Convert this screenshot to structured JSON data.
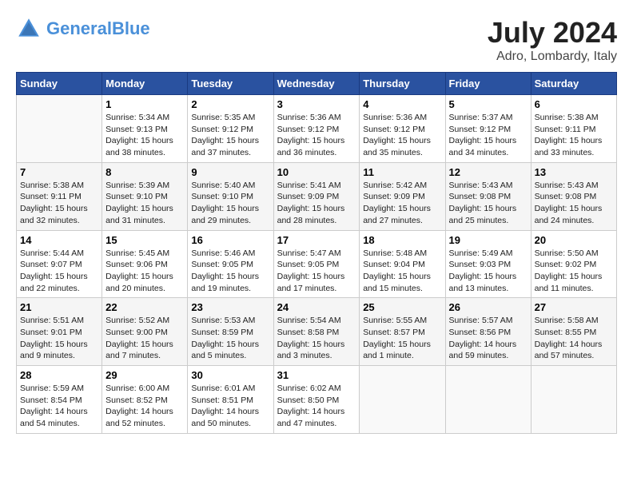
{
  "header": {
    "logo_line1": "General",
    "logo_line2": "Blue",
    "month_year": "July 2024",
    "location": "Adro, Lombardy, Italy"
  },
  "weekdays": [
    "Sunday",
    "Monday",
    "Tuesday",
    "Wednesday",
    "Thursday",
    "Friday",
    "Saturday"
  ],
  "weeks": [
    [
      {
        "day": "",
        "info": ""
      },
      {
        "day": "1",
        "info": "Sunrise: 5:34 AM\nSunset: 9:13 PM\nDaylight: 15 hours\nand 38 minutes."
      },
      {
        "day": "2",
        "info": "Sunrise: 5:35 AM\nSunset: 9:12 PM\nDaylight: 15 hours\nand 37 minutes."
      },
      {
        "day": "3",
        "info": "Sunrise: 5:36 AM\nSunset: 9:12 PM\nDaylight: 15 hours\nand 36 minutes."
      },
      {
        "day": "4",
        "info": "Sunrise: 5:36 AM\nSunset: 9:12 PM\nDaylight: 15 hours\nand 35 minutes."
      },
      {
        "day": "5",
        "info": "Sunrise: 5:37 AM\nSunset: 9:12 PM\nDaylight: 15 hours\nand 34 minutes."
      },
      {
        "day": "6",
        "info": "Sunrise: 5:38 AM\nSunset: 9:11 PM\nDaylight: 15 hours\nand 33 minutes."
      }
    ],
    [
      {
        "day": "7",
        "info": "Sunrise: 5:38 AM\nSunset: 9:11 PM\nDaylight: 15 hours\nand 32 minutes."
      },
      {
        "day": "8",
        "info": "Sunrise: 5:39 AM\nSunset: 9:10 PM\nDaylight: 15 hours\nand 31 minutes."
      },
      {
        "day": "9",
        "info": "Sunrise: 5:40 AM\nSunset: 9:10 PM\nDaylight: 15 hours\nand 29 minutes."
      },
      {
        "day": "10",
        "info": "Sunrise: 5:41 AM\nSunset: 9:09 PM\nDaylight: 15 hours\nand 28 minutes."
      },
      {
        "day": "11",
        "info": "Sunrise: 5:42 AM\nSunset: 9:09 PM\nDaylight: 15 hours\nand 27 minutes."
      },
      {
        "day": "12",
        "info": "Sunrise: 5:43 AM\nSunset: 9:08 PM\nDaylight: 15 hours\nand 25 minutes."
      },
      {
        "day": "13",
        "info": "Sunrise: 5:43 AM\nSunset: 9:08 PM\nDaylight: 15 hours\nand 24 minutes."
      }
    ],
    [
      {
        "day": "14",
        "info": "Sunrise: 5:44 AM\nSunset: 9:07 PM\nDaylight: 15 hours\nand 22 minutes."
      },
      {
        "day": "15",
        "info": "Sunrise: 5:45 AM\nSunset: 9:06 PM\nDaylight: 15 hours\nand 20 minutes."
      },
      {
        "day": "16",
        "info": "Sunrise: 5:46 AM\nSunset: 9:05 PM\nDaylight: 15 hours\nand 19 minutes."
      },
      {
        "day": "17",
        "info": "Sunrise: 5:47 AM\nSunset: 9:05 PM\nDaylight: 15 hours\nand 17 minutes."
      },
      {
        "day": "18",
        "info": "Sunrise: 5:48 AM\nSunset: 9:04 PM\nDaylight: 15 hours\nand 15 minutes."
      },
      {
        "day": "19",
        "info": "Sunrise: 5:49 AM\nSunset: 9:03 PM\nDaylight: 15 hours\nand 13 minutes."
      },
      {
        "day": "20",
        "info": "Sunrise: 5:50 AM\nSunset: 9:02 PM\nDaylight: 15 hours\nand 11 minutes."
      }
    ],
    [
      {
        "day": "21",
        "info": "Sunrise: 5:51 AM\nSunset: 9:01 PM\nDaylight: 15 hours\nand 9 minutes."
      },
      {
        "day": "22",
        "info": "Sunrise: 5:52 AM\nSunset: 9:00 PM\nDaylight: 15 hours\nand 7 minutes."
      },
      {
        "day": "23",
        "info": "Sunrise: 5:53 AM\nSunset: 8:59 PM\nDaylight: 15 hours\nand 5 minutes."
      },
      {
        "day": "24",
        "info": "Sunrise: 5:54 AM\nSunset: 8:58 PM\nDaylight: 15 hours\nand 3 minutes."
      },
      {
        "day": "25",
        "info": "Sunrise: 5:55 AM\nSunset: 8:57 PM\nDaylight: 15 hours\nand 1 minute."
      },
      {
        "day": "26",
        "info": "Sunrise: 5:57 AM\nSunset: 8:56 PM\nDaylight: 14 hours\nand 59 minutes."
      },
      {
        "day": "27",
        "info": "Sunrise: 5:58 AM\nSunset: 8:55 PM\nDaylight: 14 hours\nand 57 minutes."
      }
    ],
    [
      {
        "day": "28",
        "info": "Sunrise: 5:59 AM\nSunset: 8:54 PM\nDaylight: 14 hours\nand 54 minutes."
      },
      {
        "day": "29",
        "info": "Sunrise: 6:00 AM\nSunset: 8:52 PM\nDaylight: 14 hours\nand 52 minutes."
      },
      {
        "day": "30",
        "info": "Sunrise: 6:01 AM\nSunset: 8:51 PM\nDaylight: 14 hours\nand 50 minutes."
      },
      {
        "day": "31",
        "info": "Sunrise: 6:02 AM\nSunset: 8:50 PM\nDaylight: 14 hours\nand 47 minutes."
      },
      {
        "day": "",
        "info": ""
      },
      {
        "day": "",
        "info": ""
      },
      {
        "day": "",
        "info": ""
      }
    ]
  ]
}
